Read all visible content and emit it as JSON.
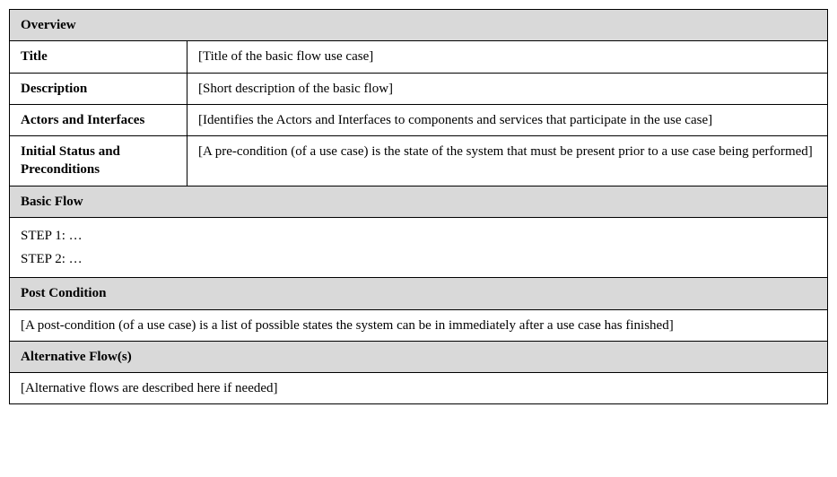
{
  "headers": {
    "overview": "Overview",
    "basic_flow": "Basic Flow",
    "post_condition": "Post Condition",
    "alternative_flows": "Alternative Flow(s)"
  },
  "overview": {
    "title_label": "Title",
    "title_value": "[Title of the basic flow use case]",
    "description_label": "Description",
    "description_value": "[Short description of the basic flow]",
    "actors_label": "Actors and Interfaces",
    "actors_value": "[Identifies the Actors and Interfaces to components and services that participate in the use case]",
    "initial_label": "Initial Status and Preconditions",
    "initial_value": "[A pre-condition (of a use case) is the state of the system that must be present prior to a use case being performed]"
  },
  "basic_flow": {
    "step1": "STEP 1: …",
    "step2": "STEP 2: …"
  },
  "post_condition": {
    "value": "[A post-condition (of a use case) is a list of possible states the system can be in immediately after a use case has finished]"
  },
  "alternative_flows": {
    "value": "[Alternative flows are described here if needed]"
  }
}
